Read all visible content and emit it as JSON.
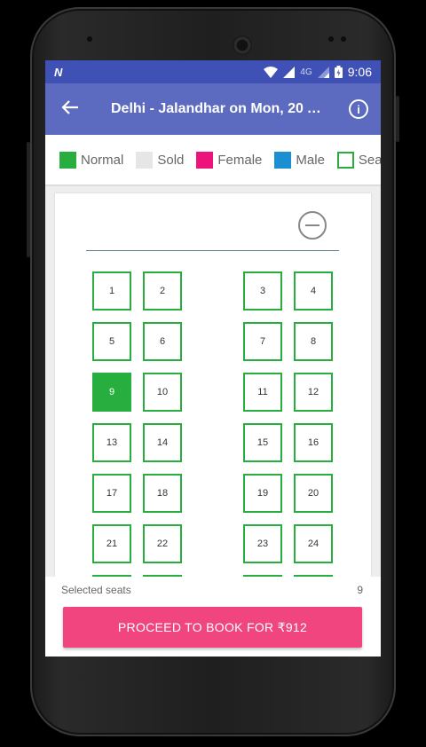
{
  "status_bar": {
    "notification_icon": "n-logo-icon",
    "network": "4G",
    "time": "9:06"
  },
  "app_bar": {
    "title": "Delhi - Jalandhar on Mon, 20 A...",
    "back_icon": "arrow-left-icon",
    "info_icon": "info-icon"
  },
  "legend": [
    {
      "label": "Normal",
      "color": "#27ae3f",
      "style": "filled"
    },
    {
      "label": "Sold",
      "color": "#e6e6e6",
      "style": "filled"
    },
    {
      "label": "Female",
      "color": "#ec147a",
      "style": "filled"
    },
    {
      "label": "Male",
      "color": "#1b8fd1",
      "style": "filled"
    },
    {
      "label": "Sea",
      "color": "#27ae3f",
      "style": "outline"
    }
  ],
  "seats": [
    {
      "number": "1",
      "state": "available"
    },
    {
      "number": "2",
      "state": "available"
    },
    {
      "number": "3",
      "state": "available"
    },
    {
      "number": "4",
      "state": "available"
    },
    {
      "number": "5",
      "state": "available"
    },
    {
      "number": "6",
      "state": "available"
    },
    {
      "number": "7",
      "state": "available"
    },
    {
      "number": "8",
      "state": "available"
    },
    {
      "number": "9",
      "state": "selected"
    },
    {
      "number": "10",
      "state": "available"
    },
    {
      "number": "11",
      "state": "available"
    },
    {
      "number": "12",
      "state": "available"
    },
    {
      "number": "13",
      "state": "available"
    },
    {
      "number": "14",
      "state": "available"
    },
    {
      "number": "15",
      "state": "available"
    },
    {
      "number": "16",
      "state": "available"
    },
    {
      "number": "17",
      "state": "available"
    },
    {
      "number": "18",
      "state": "available"
    },
    {
      "number": "19",
      "state": "available"
    },
    {
      "number": "20",
      "state": "available"
    },
    {
      "number": "21",
      "state": "available"
    },
    {
      "number": "22",
      "state": "available"
    },
    {
      "number": "23",
      "state": "available"
    },
    {
      "number": "24",
      "state": "available"
    },
    {
      "number": "",
      "state": "available"
    },
    {
      "number": "",
      "state": "available"
    },
    {
      "number": "",
      "state": "available"
    },
    {
      "number": "",
      "state": "available"
    }
  ],
  "footer": {
    "selected_label": "Selected seats",
    "selected_value": "9",
    "proceed_label": "PROCEED TO BOOK FOR ₹912"
  },
  "colors": {
    "primary": "#5c6bc0",
    "primary_dark": "#3f51b5",
    "accent": "#f0457f",
    "seat_border": "#27ae3f"
  }
}
